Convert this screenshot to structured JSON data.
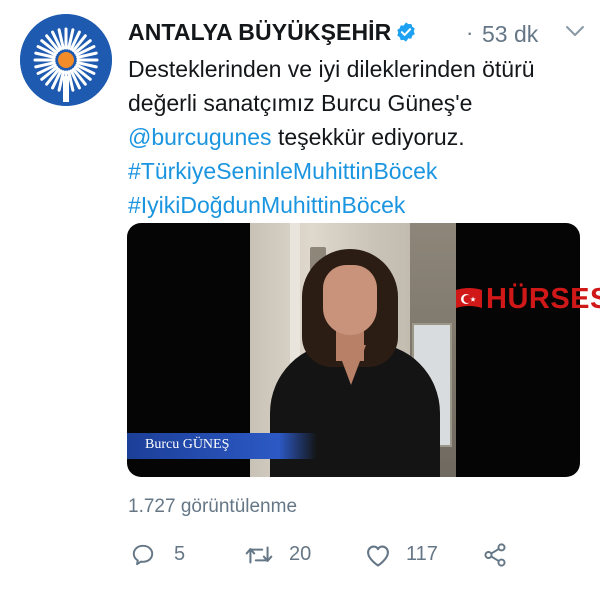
{
  "tweet": {
    "author_name": "ANTALYA BÜYÜKŞEHİR",
    "separator": "·",
    "time": "53 dk",
    "text_lines": [
      "Desteklerinden ve iyi dileklerinden ötürü",
      "değerli sanatçımız Burcu Güneş'e"
    ],
    "mention": "@burcugunes",
    "mention_suffix": " teşekkür ediyoruz.",
    "hashtags": [
      "#TürkiyeSeninleMuhittinBöcek",
      "#IyikiDoğdunMuhittinBöcek"
    ]
  },
  "media": {
    "caption_name": "Burcu GÜNEŞ",
    "watermark": "HÜRSES"
  },
  "stats": {
    "views": "1.727 görüntülenme",
    "replies": "5",
    "retweets": "20",
    "likes": "117"
  },
  "icons": {
    "verified": "verified-badge-icon",
    "more": "chevron-down-icon",
    "reply": "reply-icon",
    "retweet": "retweet-icon",
    "like": "heart-icon",
    "share": "share-icon"
  },
  "colors": {
    "link": "#1b95e0",
    "muted": "#657786",
    "verified": "#1da1f2",
    "brand_blue": "#1e5bb0",
    "watermark_red": "#d01818"
  }
}
